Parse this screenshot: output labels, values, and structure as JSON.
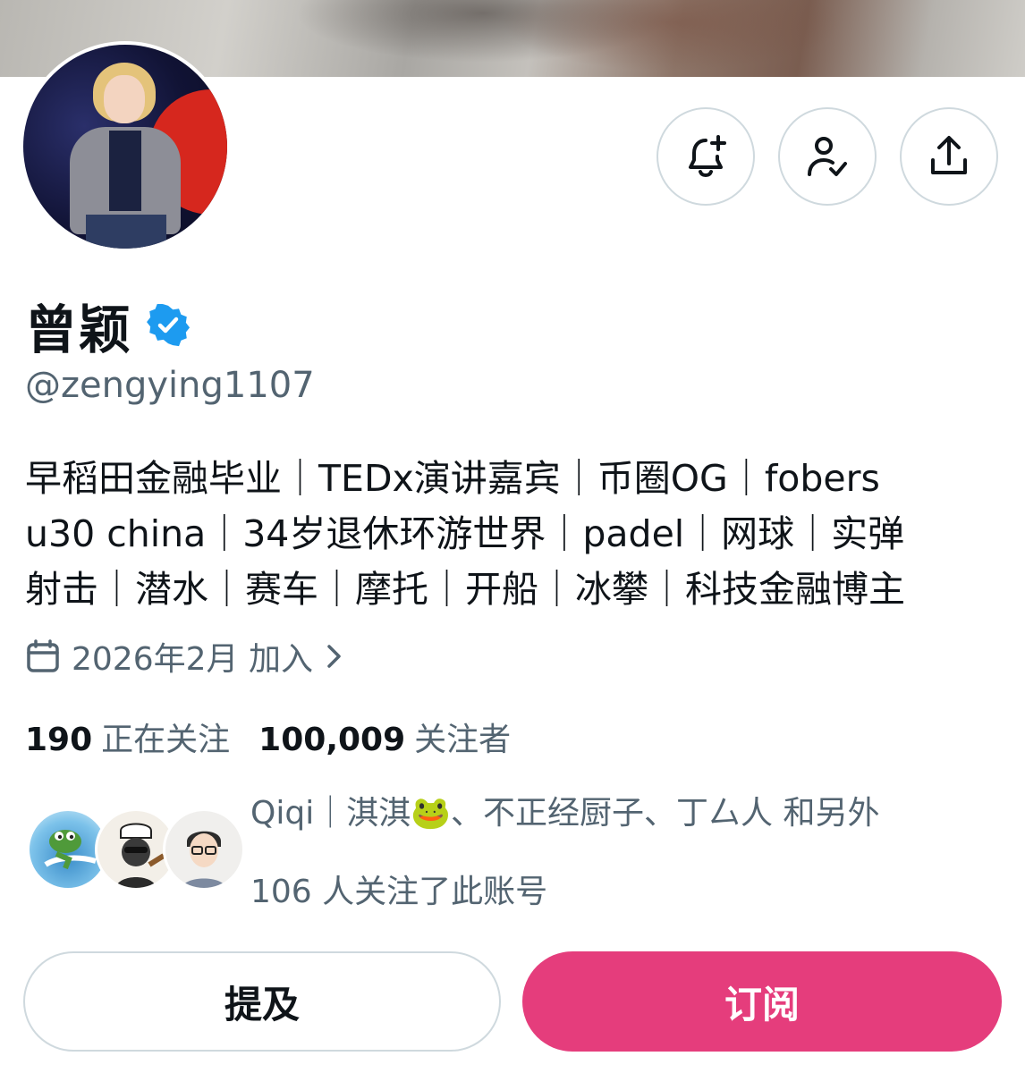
{
  "profile": {
    "name": "曾颖",
    "handle": "@zengying1107",
    "bio_lines": [
      "早稻田金融毕业｜TEDx演讲嘉宾｜币圈OG｜fobers",
      "u30 china｜34岁退休环游世界｜padel｜网球｜实弹",
      "射击｜潜水｜赛车｜摩托｜开船｜冰攀｜科技金融博主"
    ],
    "joined": "2026年2月 加入",
    "verified_color": "#1d9bf0"
  },
  "stats": {
    "following_count": "190",
    "following_label": "正在关注",
    "followers_count": "100,009",
    "followers_label": "关注者"
  },
  "followers_you_know": {
    "names_line": "Qiqi｜淇淇🐸、不正经厨子、丁厶人 和另外",
    "count_line": "106 人关注了此账号"
  },
  "actions": {
    "notify_icon": "bell-plus-icon",
    "follow_icon": "person-check-icon",
    "share_icon": "share-icon",
    "mention_label": "提及",
    "subscribe_label": "订阅",
    "subscribe_color": "#e53d7c"
  }
}
